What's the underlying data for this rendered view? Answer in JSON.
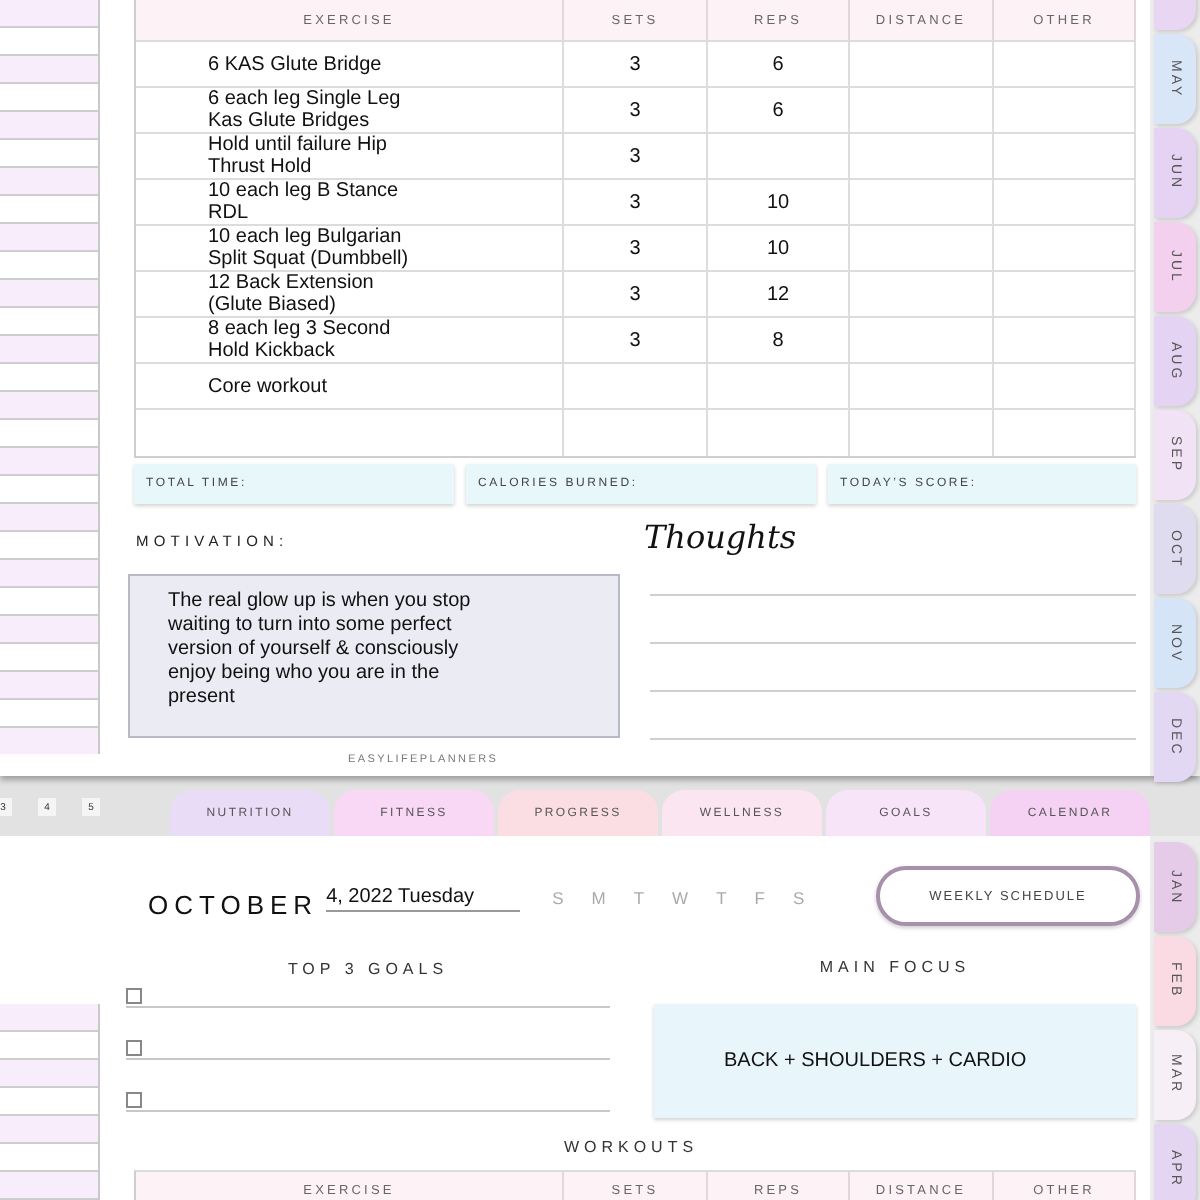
{
  "top_page": {
    "month_tabs": [
      {
        "color": "#e9d6f3"
      },
      {
        "label": "MAY",
        "color": "#d8e6f8"
      },
      {
        "label": "JUN",
        "color": "#e6d2f3"
      },
      {
        "label": "JUL",
        "color": "#f3d1ee"
      },
      {
        "label": "AUG",
        "color": "#e4d3f3"
      },
      {
        "label": "SEP",
        "color": "#f1e2f6"
      },
      {
        "label": "OCT",
        "color": "#e0dcf0"
      },
      {
        "label": "NOV",
        "color": "#d6e4f7"
      },
      {
        "label": "DEC",
        "color": "#e2d8f3"
      }
    ],
    "workouts": {
      "columns": [
        "EXERCISE",
        "SETS",
        "REPS",
        "DISTANCE",
        "OTHER"
      ],
      "rows": [
        {
          "exercise": "6 KAS Glute Bridge",
          "sets": "3",
          "reps": "6"
        },
        {
          "exercise": "6 each leg Single Leg Kas Glute Bridges",
          "sets": "3",
          "reps": "6"
        },
        {
          "exercise": "Hold until failure Hip Thrust Hold",
          "sets": "3"
        },
        {
          "exercise": "10 each leg B Stance RDL",
          "sets": "3",
          "reps": "10"
        },
        {
          "exercise": "10 each leg Bulgarian Split Squat (Dumbbell)",
          "sets": "3",
          "reps": "10"
        },
        {
          "exercise": "12 Back Extension (Glute Biased)",
          "sets": "3",
          "reps": "12"
        },
        {
          "exercise": "8 each leg 3 Second Hold Kickback",
          "sets": "3",
          "reps": "8"
        },
        {
          "exercise": "Core workout"
        }
      ]
    },
    "summary_fields": [
      {
        "label": "TOTAL TIME:"
      },
      {
        "label": "CALORIES BURNED:"
      },
      {
        "label": "TODAY’S SCORE:"
      }
    ],
    "motivation": {
      "label": "MOTIVATION:",
      "text": "The real glow up is when you stop waiting to turn into some perfect version of yourself & consciously enjoy being who you are in the present"
    },
    "thoughts": {
      "title": "Thoughts"
    },
    "footer": "EASYLIFEPLANNERS"
  },
  "page_numbers": [
    "3",
    "4",
    "5"
  ],
  "section_tabs": [
    {
      "label": "NUTRITION",
      "color": "#e8dcf7"
    },
    {
      "label": "FITNESS",
      "color": "#f8d8f5"
    },
    {
      "label": "PROGRESS",
      "color": "#fbdde4"
    },
    {
      "label": "WELLNESS",
      "color": "#fbe5f1"
    },
    {
      "label": "GOALS",
      "color": "#f8e4f8"
    },
    {
      "label": "CALENDAR",
      "color": "#f5d2f3"
    }
  ],
  "bottom_page": {
    "month_tabs": [
      {
        "label": "JAN",
        "color": "#e6cbe9"
      },
      {
        "label": "FEB",
        "color": "#fbdbe3"
      },
      {
        "label": "MAR",
        "color": "#f7eff6"
      },
      {
        "label": "APR",
        "color": "#e4d6f3"
      }
    ],
    "month": "OCTOBER",
    "date": "4, 2022 Tuesday",
    "weekdays": [
      "S",
      "M",
      "T",
      "W",
      "T",
      "F",
      "S"
    ],
    "weekly_schedule_button": "WEEKLY SCHEDULE",
    "top_goals": {
      "title": "TOP 3 GOALS",
      "items": [
        {
          "checked": false
        },
        {
          "checked": false
        },
        {
          "checked": false
        }
      ]
    },
    "main_focus": {
      "title": "MAIN FOCUS",
      "text": "BACK + SHOULDERS + CARDIO"
    },
    "workouts": {
      "title": "WORKOUTS",
      "columns": [
        "EXERCISE",
        "SETS",
        "REPS",
        "DISTANCE",
        "OTHER"
      ]
    }
  }
}
